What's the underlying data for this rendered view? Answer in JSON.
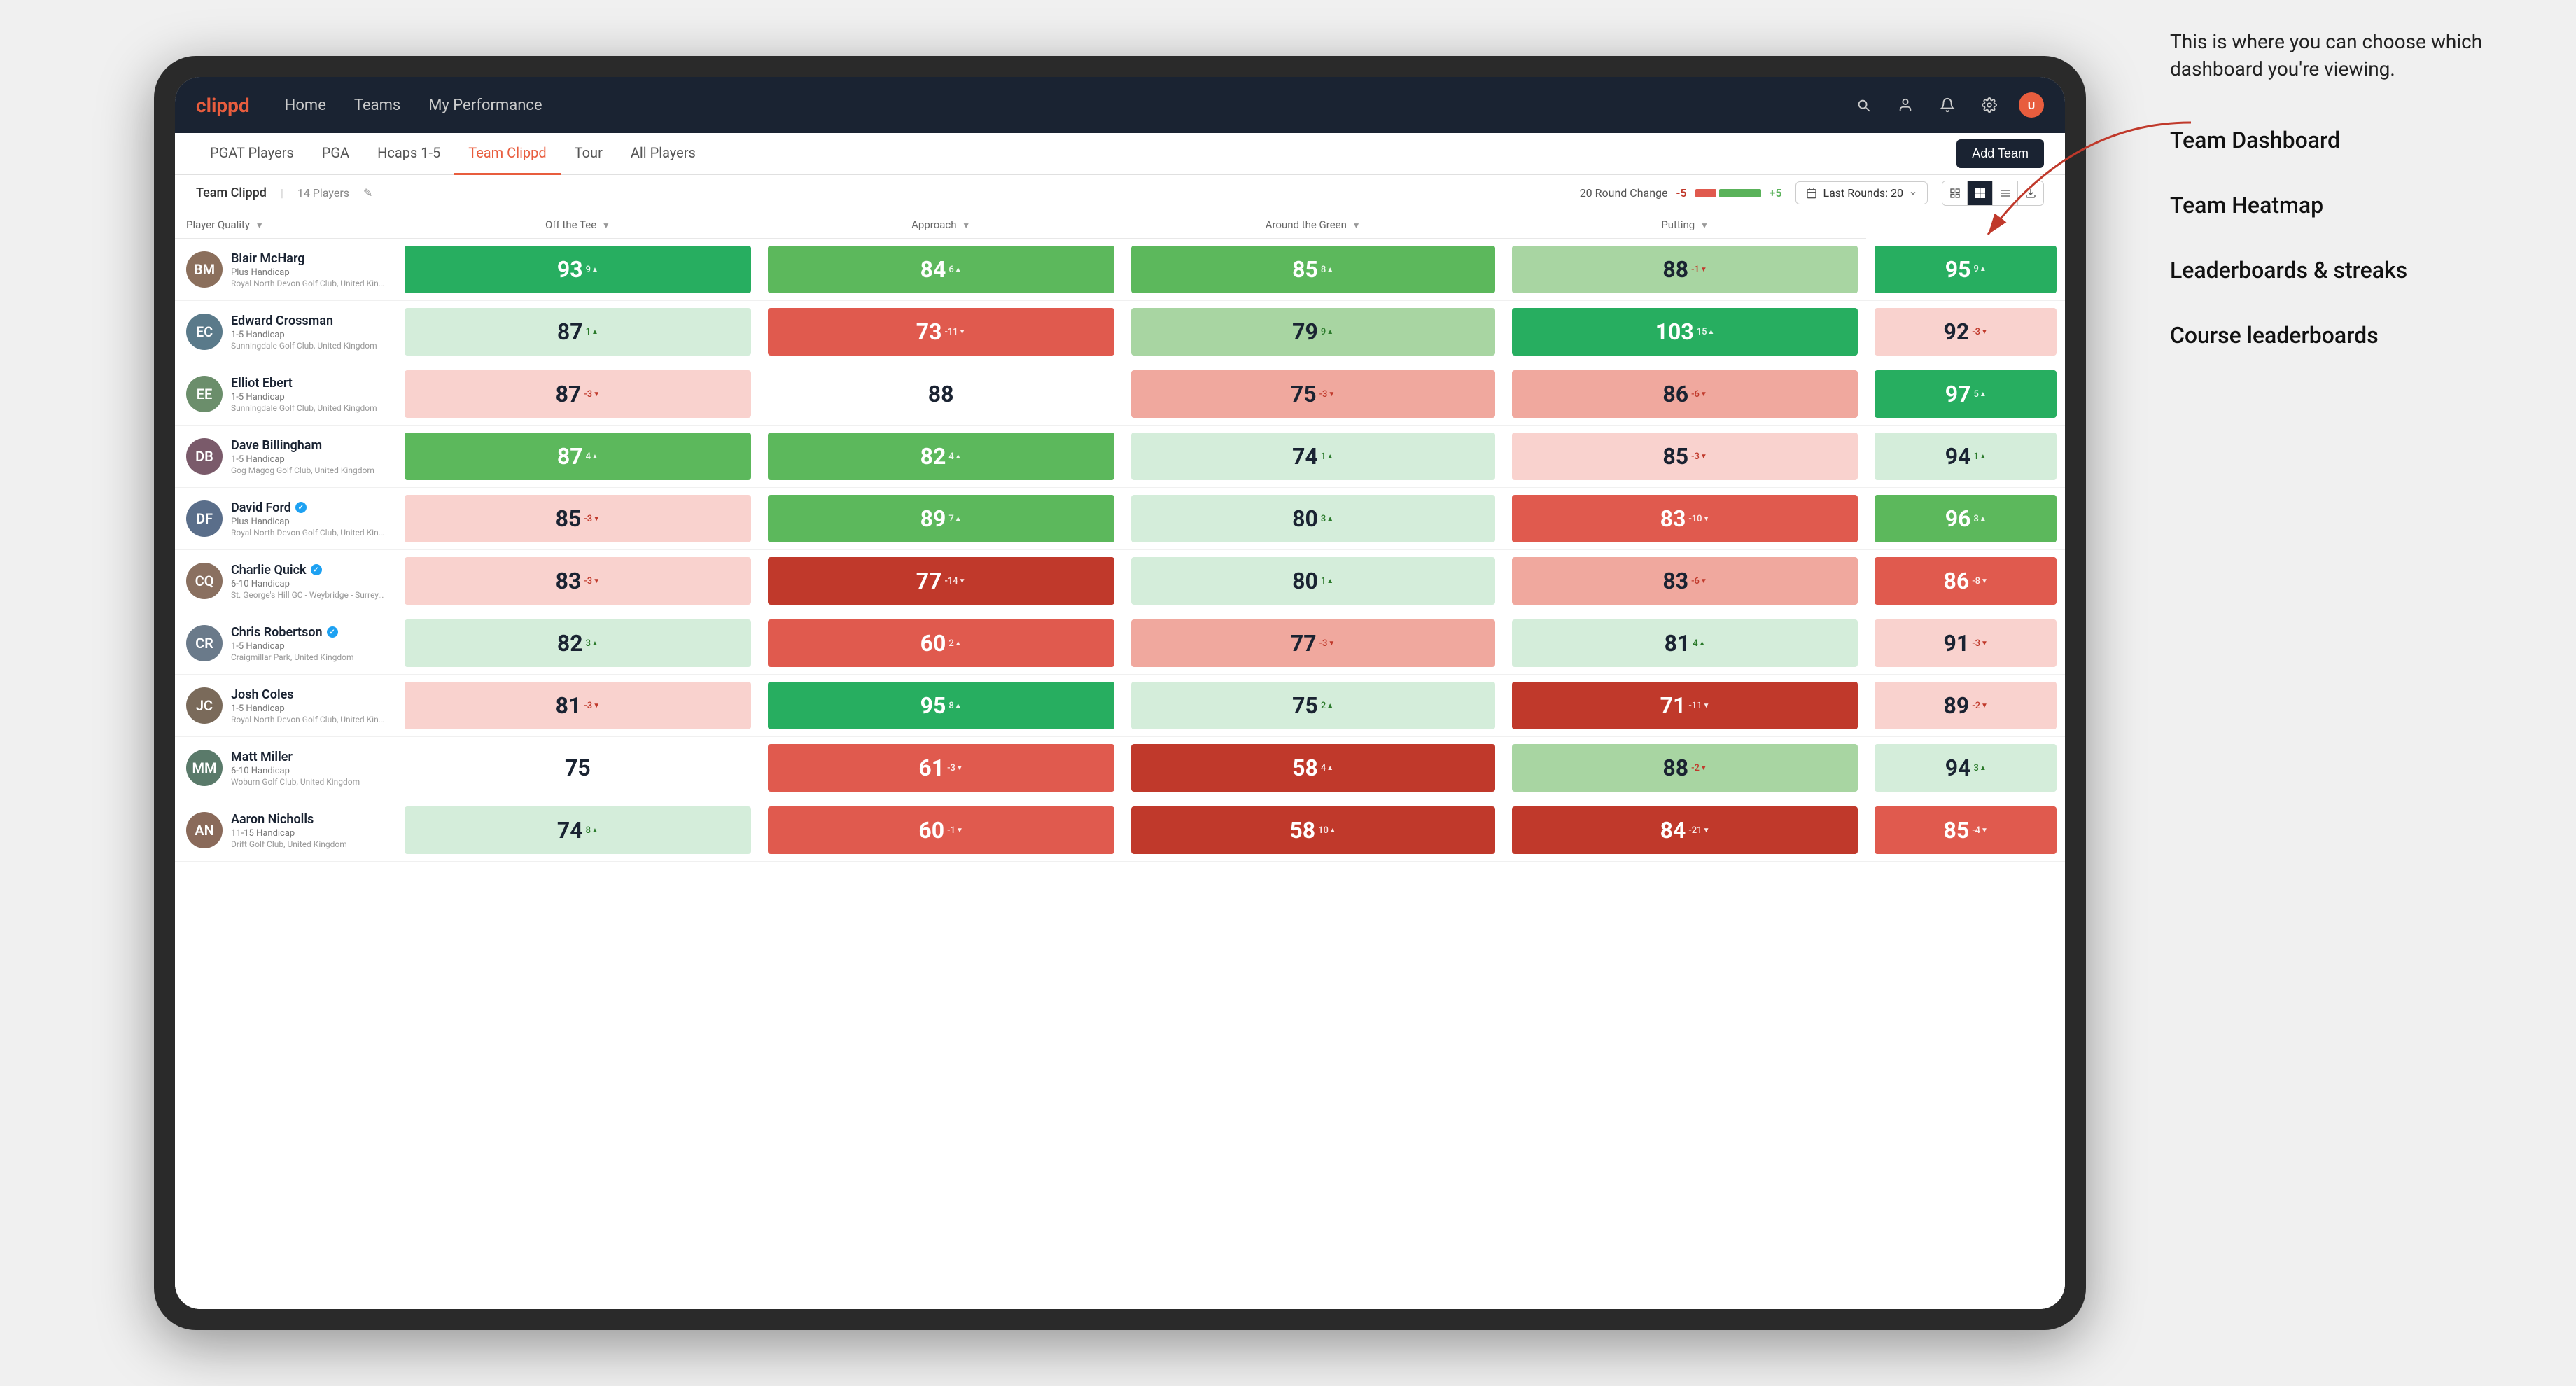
{
  "annotation": {
    "intro_text": "This is where you can choose which dashboard you're viewing.",
    "menu_items": [
      "Team Dashboard",
      "Team Heatmap",
      "Leaderboards & streaks",
      "Course leaderboards"
    ]
  },
  "nav": {
    "logo": "clippd",
    "links": [
      "Home",
      "Teams",
      "My Performance"
    ],
    "icons": [
      "search",
      "person",
      "bell",
      "settings",
      "avatar"
    ]
  },
  "sub_tabs": [
    "PGAT Players",
    "PGA",
    "Hcaps 1-5",
    "Team Clippd",
    "Tour",
    "All Players"
  ],
  "active_sub_tab": "Team Clippd",
  "add_team_label": "Add Team",
  "team_bar": {
    "team_name": "Team Clippd",
    "separator": "|",
    "players_count": "14 Players",
    "round_change_label": "20 Round Change",
    "change_minus": "-5",
    "change_plus": "+5",
    "last_rounds_label": "Last Rounds:",
    "last_rounds_value": "20"
  },
  "table": {
    "columns": [
      "Player Quality ▼",
      "Off the Tee ▼",
      "Approach ▼",
      "Around the Green ▼",
      "Putting ▼"
    ],
    "rows": [
      {
        "name": "Blair McHarg",
        "handicap": "Plus Handicap",
        "club": "Royal North Devon Golf Club, United Kingdom",
        "avatar_initials": "BM",
        "avatar_color": "#8B7355",
        "metrics": [
          {
            "value": "93",
            "change": "9▲",
            "bg": "green-strong"
          },
          {
            "value": "84",
            "change": "6▲",
            "bg": "green-mid"
          },
          {
            "value": "85",
            "change": "8▲",
            "bg": "green-mid"
          },
          {
            "value": "88",
            "change": "-1▼",
            "bg": "green-light"
          },
          {
            "value": "95",
            "change": "9▲",
            "bg": "green-strong"
          }
        ]
      },
      {
        "name": "Edward Crossman",
        "handicap": "1-5 Handicap",
        "club": "Sunningdale Golf Club, United Kingdom",
        "avatar_initials": "EC",
        "avatar_color": "#6B8E6B",
        "metrics": [
          {
            "value": "87",
            "change": "1▲",
            "bg": "green-pale"
          },
          {
            "value": "73",
            "change": "-11▼",
            "bg": "red-mid"
          },
          {
            "value": "79",
            "change": "9▲",
            "bg": "green-light"
          },
          {
            "value": "103",
            "change": "15▲",
            "bg": "green-strong"
          },
          {
            "value": "92",
            "change": "-3▼",
            "bg": "red-pale"
          }
        ]
      },
      {
        "name": "Elliot Ebert",
        "handicap": "1-5 Handicap",
        "club": "Sunningdale Golf Club, United Kingdom",
        "avatar_initials": "EE",
        "avatar_color": "#5a6e8a",
        "metrics": [
          {
            "value": "87",
            "change": "-3▼",
            "bg": "red-pale"
          },
          {
            "value": "88",
            "change": "",
            "bg": "white"
          },
          {
            "value": "75",
            "change": "-3▼",
            "bg": "red-light"
          },
          {
            "value": "86",
            "change": "-6▼",
            "bg": "red-light"
          },
          {
            "value": "97",
            "change": "5▲",
            "bg": "green-strong"
          }
        ]
      },
      {
        "name": "Dave Billingham",
        "handicap": "1-5 Handicap",
        "club": "Gog Magog Golf Club, United Kingdom",
        "avatar_initials": "DB",
        "avatar_color": "#7a6a5a",
        "metrics": [
          {
            "value": "87",
            "change": "4▲",
            "bg": "green-mid"
          },
          {
            "value": "82",
            "change": "4▲",
            "bg": "green-mid"
          },
          {
            "value": "74",
            "change": "1▲",
            "bg": "green-pale"
          },
          {
            "value": "85",
            "change": "-3▼",
            "bg": "red-pale"
          },
          {
            "value": "94",
            "change": "1▲",
            "bg": "green-pale"
          }
        ]
      },
      {
        "name": "David Ford",
        "handicap": "Plus Handicap",
        "club": "Royal North Devon Golf Club, United Kingdom",
        "avatar_initials": "DF",
        "avatar_color": "#6a7a8a",
        "verified": true,
        "metrics": [
          {
            "value": "85",
            "change": "-3▼",
            "bg": "red-pale"
          },
          {
            "value": "89",
            "change": "7▲",
            "bg": "green-mid"
          },
          {
            "value": "80",
            "change": "3▲",
            "bg": "green-pale"
          },
          {
            "value": "83",
            "change": "-10▼",
            "bg": "red-mid"
          },
          {
            "value": "96",
            "change": "3▲",
            "bg": "green-mid"
          }
        ]
      },
      {
        "name": "Charlie Quick",
        "handicap": "6-10 Handicap",
        "club": "St. George's Hill GC - Weybridge - Surrey, Uni...",
        "avatar_initials": "CQ",
        "avatar_color": "#8a7a6a",
        "verified": true,
        "metrics": [
          {
            "value": "83",
            "change": "-3▼",
            "bg": "red-pale"
          },
          {
            "value": "77",
            "change": "-14▼",
            "bg": "red-strong"
          },
          {
            "value": "80",
            "change": "1▲",
            "bg": "green-pale"
          },
          {
            "value": "83",
            "change": "-6▼",
            "bg": "red-light"
          },
          {
            "value": "86",
            "change": "-8▼",
            "bg": "red-mid"
          }
        ]
      },
      {
        "name": "Chris Robertson",
        "handicap": "1-5 Handicap",
        "club": "Craigmillar Park, United Kingdom",
        "avatar_initials": "CR",
        "avatar_color": "#5a7a6a",
        "verified": true,
        "metrics": [
          {
            "value": "82",
            "change": "3▲",
            "bg": "green-pale"
          },
          {
            "value": "60",
            "change": "2▲",
            "bg": "red-mid"
          },
          {
            "value": "77",
            "change": "-3▼",
            "bg": "red-light"
          },
          {
            "value": "81",
            "change": "4▲",
            "bg": "green-pale"
          },
          {
            "value": "91",
            "change": "-3▼",
            "bg": "red-pale"
          }
        ]
      },
      {
        "name": "Josh Coles",
        "handicap": "1-5 Handicap",
        "club": "Royal North Devon Golf Club, United Kingdom",
        "avatar_initials": "JC",
        "avatar_color": "#7a5a4a",
        "metrics": [
          {
            "value": "81",
            "change": "-3▼",
            "bg": "red-pale"
          },
          {
            "value": "95",
            "change": "8▲",
            "bg": "green-strong"
          },
          {
            "value": "75",
            "change": "2▲",
            "bg": "green-pale"
          },
          {
            "value": "71",
            "change": "-11▼",
            "bg": "red-strong"
          },
          {
            "value": "89",
            "change": "-2▼",
            "bg": "red-pale"
          }
        ]
      },
      {
        "name": "Matt Miller",
        "handicap": "6-10 Handicap",
        "club": "Woburn Golf Club, United Kingdom",
        "avatar_initials": "MM",
        "avatar_color": "#6a6a7a",
        "metrics": [
          {
            "value": "75",
            "change": "",
            "bg": "white"
          },
          {
            "value": "61",
            "change": "-3▼",
            "bg": "red-mid"
          },
          {
            "value": "58",
            "change": "4▲",
            "bg": "red-strong"
          },
          {
            "value": "88",
            "change": "-2▼",
            "bg": "green-light"
          },
          {
            "value": "94",
            "change": "3▲",
            "bg": "green-pale"
          }
        ]
      },
      {
        "name": "Aaron Nicholls",
        "handicap": "11-15 Handicap",
        "club": "Drift Golf Club, United Kingdom",
        "avatar_initials": "AN",
        "avatar_color": "#8a6a5a",
        "metrics": [
          {
            "value": "74",
            "change": "8▲",
            "bg": "green-pale"
          },
          {
            "value": "60",
            "change": "-1▼",
            "bg": "red-mid"
          },
          {
            "value": "58",
            "change": "10▲",
            "bg": "red-strong"
          },
          {
            "value": "84",
            "change": "-21▼",
            "bg": "red-strong"
          },
          {
            "value": "85",
            "change": "-4▼",
            "bg": "red-mid"
          }
        ]
      }
    ]
  }
}
